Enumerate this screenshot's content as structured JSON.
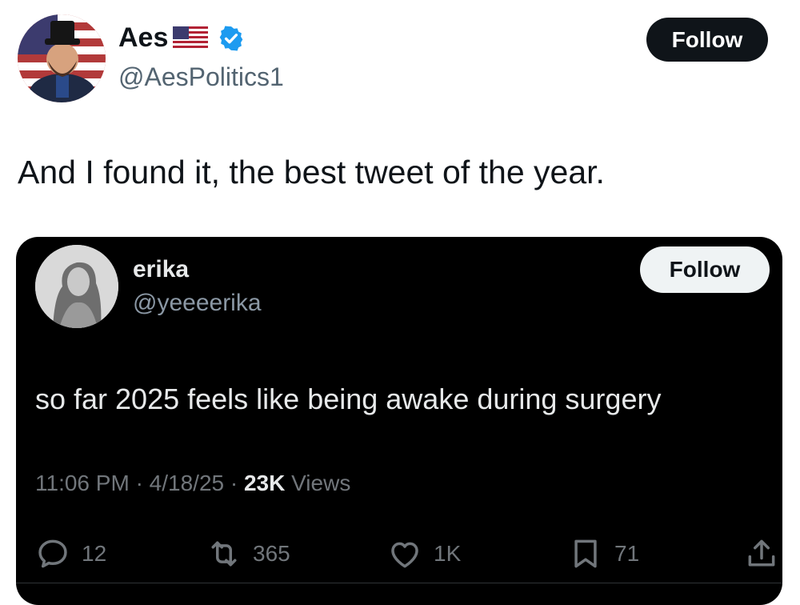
{
  "outer": {
    "author_name": "Aes",
    "author_handle": "@AesPolitics1",
    "follow_label": "Follow",
    "tweet_text": "And I found it, the best tweet of the year.",
    "icons": [
      "avatar",
      "us-flag-icon",
      "verified-badge-icon"
    ],
    "colors": {
      "verified": "#1d9bf0",
      "follow_bg": "#0f1419"
    }
  },
  "quote": {
    "author_name": "erika",
    "author_handle": "@yeeeerika",
    "follow_label": "Follow",
    "text": "so far 2025 feels like being awake during surgery",
    "time": "11:06 PM",
    "date": "4/18/25",
    "views_count": "23K",
    "views_label": "Views",
    "actions": {
      "replies": "12",
      "reposts": "365",
      "likes": "1K",
      "bookmarks": "71"
    },
    "icons": [
      "reply-icon",
      "repost-icon",
      "like-icon",
      "bookmark-icon",
      "share-icon"
    ],
    "colors": {
      "card_bg": "#000000",
      "muted": "#71767b"
    }
  }
}
